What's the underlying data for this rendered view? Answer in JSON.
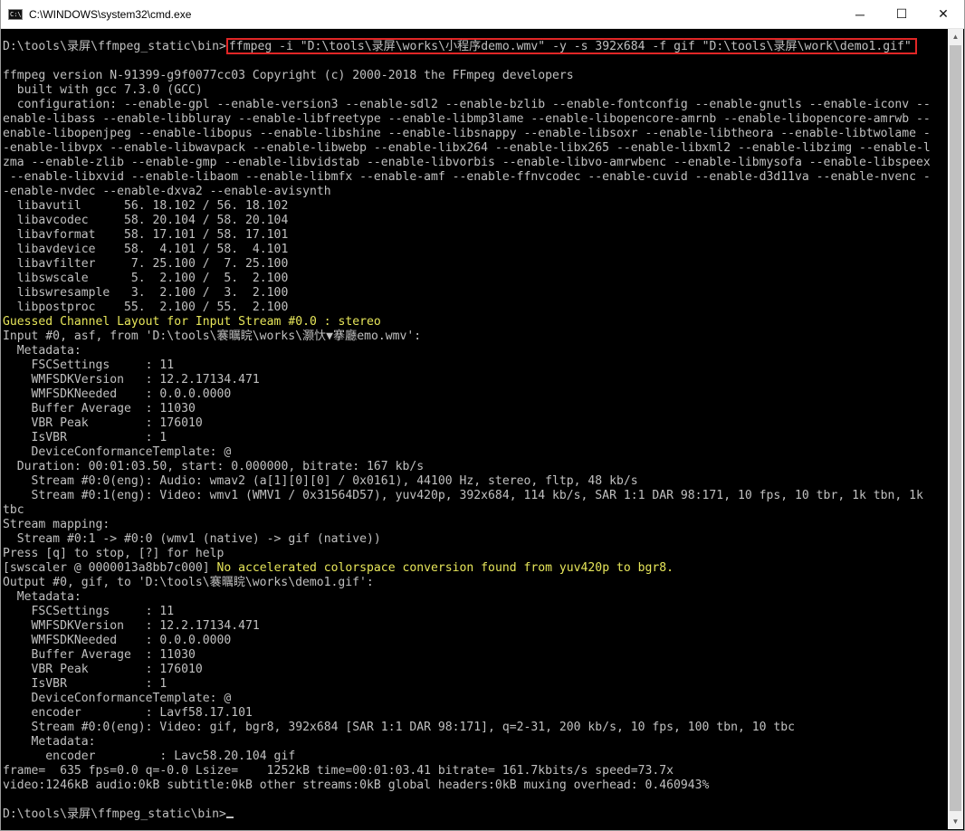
{
  "window": {
    "title": "C:\\WINDOWS\\system32\\cmd.exe",
    "icon": "cmd-icon",
    "controls": {
      "minimize": "─",
      "maximize": "☐",
      "close": "✕"
    }
  },
  "terminal": {
    "prompt": "D:\\tools\\录屏\\ffmpeg_static\\bin>",
    "command": "ffmpeg -i \"D:\\tools\\录屏\\works\\小程序demo.wmv\" -y -s 392x684 -f gif \"D:\\tools\\录屏\\work\\demo1.gif\"",
    "lines_top": [
      "",
      "ffmpeg version N-91399-g9f0077cc03 Copyright (c) 2000-2018 the FFmpeg developers",
      "  built with gcc 7.3.0 (GCC)",
      "  configuration: --enable-gpl --enable-version3 --enable-sdl2 --enable-bzlib --enable-fontconfig --enable-gnutls --enable-iconv --",
      "enable-libass --enable-libbluray --enable-libfreetype --enable-libmp3lame --enable-libopencore-amrnb --enable-libopencore-amrwb --",
      "enable-libopenjpeg --enable-libopus --enable-libshine --enable-libsnappy --enable-libsoxr --enable-libtheora --enable-libtwolame -",
      "-enable-libvpx --enable-libwavpack --enable-libwebp --enable-libx264 --enable-libx265 --enable-libxml2 --enable-libzimg --enable-l",
      "zma --enable-zlib --enable-gmp --enable-libvidstab --enable-libvorbis --enable-libvo-amrwbenc --enable-libmysofa --enable-libspeex",
      " --enable-libxvid --enable-libaom --enable-libmfx --enable-amf --enable-ffnvcodec --enable-cuvid --enable-d3d11va --enable-nvenc -",
      "-enable-nvdec --enable-dxva2 --enable-avisynth",
      "  libavutil      56. 18.102 / 56. 18.102",
      "  libavcodec     58. 20.104 / 58. 20.104",
      "  libavformat    58. 17.101 / 58. 17.101",
      "  libavdevice    58.  4.101 / 58.  4.101",
      "  libavfilter     7. 25.100 /  7. 25.100",
      "  libswscale      5.  2.100 /  5.  2.100",
      "  libswresample   3.  2.100 /  3.  2.100",
      "  libpostproc    55.  2.100 / 55.  2.100"
    ],
    "guessed_layout": "Guessed Channel Layout for Input Stream #0.0 : stereo",
    "lines_mid": [
      "Input #0, asf, from 'D:\\tools\\褰曞睆\\works\\灏忕▼搴廳emo.wmv':",
      "  Metadata:",
      "    FSCSettings     : 11",
      "    WMFSDKVersion   : 12.2.17134.471",
      "    WMFSDKNeeded    : 0.0.0.0000",
      "    Buffer Average  : 11030",
      "    VBR Peak        : 176010",
      "    IsVBR           : 1",
      "    DeviceConformanceTemplate: @",
      "  Duration: 00:01:03.50, start: 0.000000, bitrate: 167 kb/s",
      "    Stream #0:0(eng): Audio: wmav2 (a[1][0][0] / 0x0161), 44100 Hz, stereo, fltp, 48 kb/s",
      "    Stream #0:1(eng): Video: wmv1 (WMV1 / 0x31564D57), yuv420p, 392x684, 114 kb/s, SAR 1:1 DAR 98:171, 10 fps, 10 tbr, 1k tbn, 1k",
      "tbc",
      "Stream mapping:",
      "  Stream #0:1 -> #0:0 (wmv1 (native) -> gif (native))",
      "Press [q] to stop, [?] for help"
    ],
    "swscaler_prefix": "[swscaler @ 0000013a8bb7c000] ",
    "swscaler_msg": "No accelerated colorspace conversion found from yuv420p to bgr8.",
    "lines_bottom": [
      "Output #0, gif, to 'D:\\tools\\褰曞睆\\works\\demo1.gif':",
      "  Metadata:",
      "    FSCSettings     : 11",
      "    WMFSDKVersion   : 12.2.17134.471",
      "    WMFSDKNeeded    : 0.0.0.0000",
      "    Buffer Average  : 11030",
      "    VBR Peak        : 176010",
      "    IsVBR           : 1",
      "    DeviceConformanceTemplate: @",
      "    encoder         : Lavf58.17.101",
      "    Stream #0:0(eng): Video: gif, bgr8, 392x684 [SAR 1:1 DAR 98:171], q=2-31, 200 kb/s, 10 fps, 100 tbn, 10 tbc",
      "    Metadata:",
      "      encoder         : Lavc58.20.104 gif",
      "frame=  635 fps=0.0 q=-0.0 Lsize=    1252kB time=00:01:03.41 bitrate= 161.7kbits/s speed=73.7x",
      "video:1246kB audio:0kB subtitle:0kB other streams:0kB global headers:0kB muxing overhead: 0.460943%",
      ""
    ],
    "final_prompt": "D:\\tools\\录屏\\ffmpeg_static\\bin>"
  },
  "colors": {
    "terminal_bg": "#000000",
    "terminal_fg": "#c0c0c0",
    "warning": "#e7e65a",
    "highlight_box": "#e12626"
  }
}
